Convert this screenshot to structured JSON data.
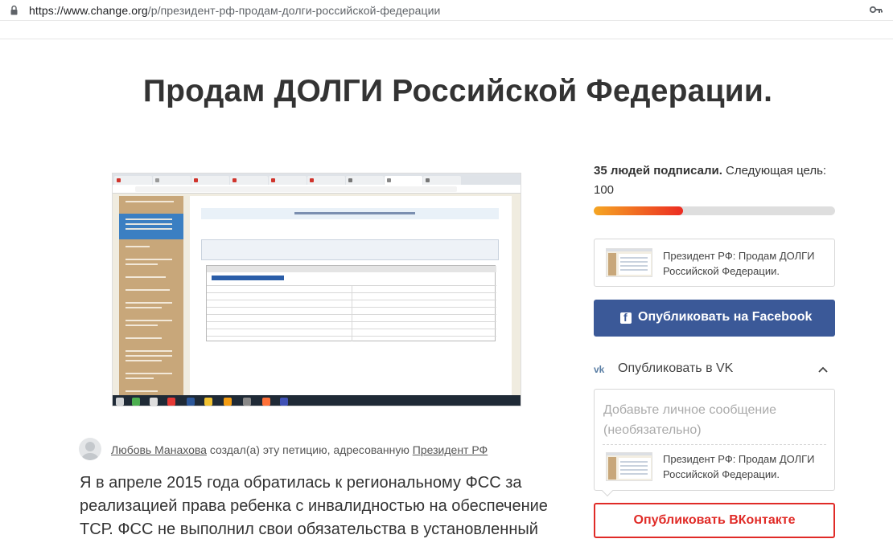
{
  "browser": {
    "url_host": "https://www.change.org",
    "url_path": "/p/президент-рф-продам-долги-российской-федерации"
  },
  "petition": {
    "title": "Продам ДОЛГИ Российской Федерации.",
    "author_name": "Любовь Манахова",
    "author_mid": " создал(а) эту петицию, адресованную ",
    "recipient": "Президент РФ",
    "body_line_1": "Я в апреле 2015 года обратилась к региональному ФСС за",
    "body_line_2": "реализацией права ребенка с инвалидностью на обеспечение",
    "body_line_3": "ТСР. ФСС не выполнил свои обязательства в установленный"
  },
  "progress": {
    "signed_bold": "35 людей подписали.",
    "signed_rest": " Следующая цель: 100",
    "signed": 35,
    "goal": 100,
    "fill_fraction": 0.37,
    "color_start": "#f5a623",
    "color_end": "#ec2c22"
  },
  "share": {
    "preview_caption": "Президент РФ: Продам ДОЛГИ Российской Федерации.",
    "facebook_label": "Опубликовать на Facebook",
    "facebook_icon": "facebook-icon",
    "facebook_color": "#3b5998",
    "vk_toggle_label": "Опубликовать в VK",
    "vk_icon": "vk-icon",
    "vk_message_placeholder": "Добавьте личное сообщение (необязательно)",
    "vk_preview_caption": "Президент РФ: Продам ДОЛГИ Российской Федерации.",
    "vk_button_label": "Опубликовать ВКонтакте",
    "vk_button_color": "#e02b27"
  }
}
